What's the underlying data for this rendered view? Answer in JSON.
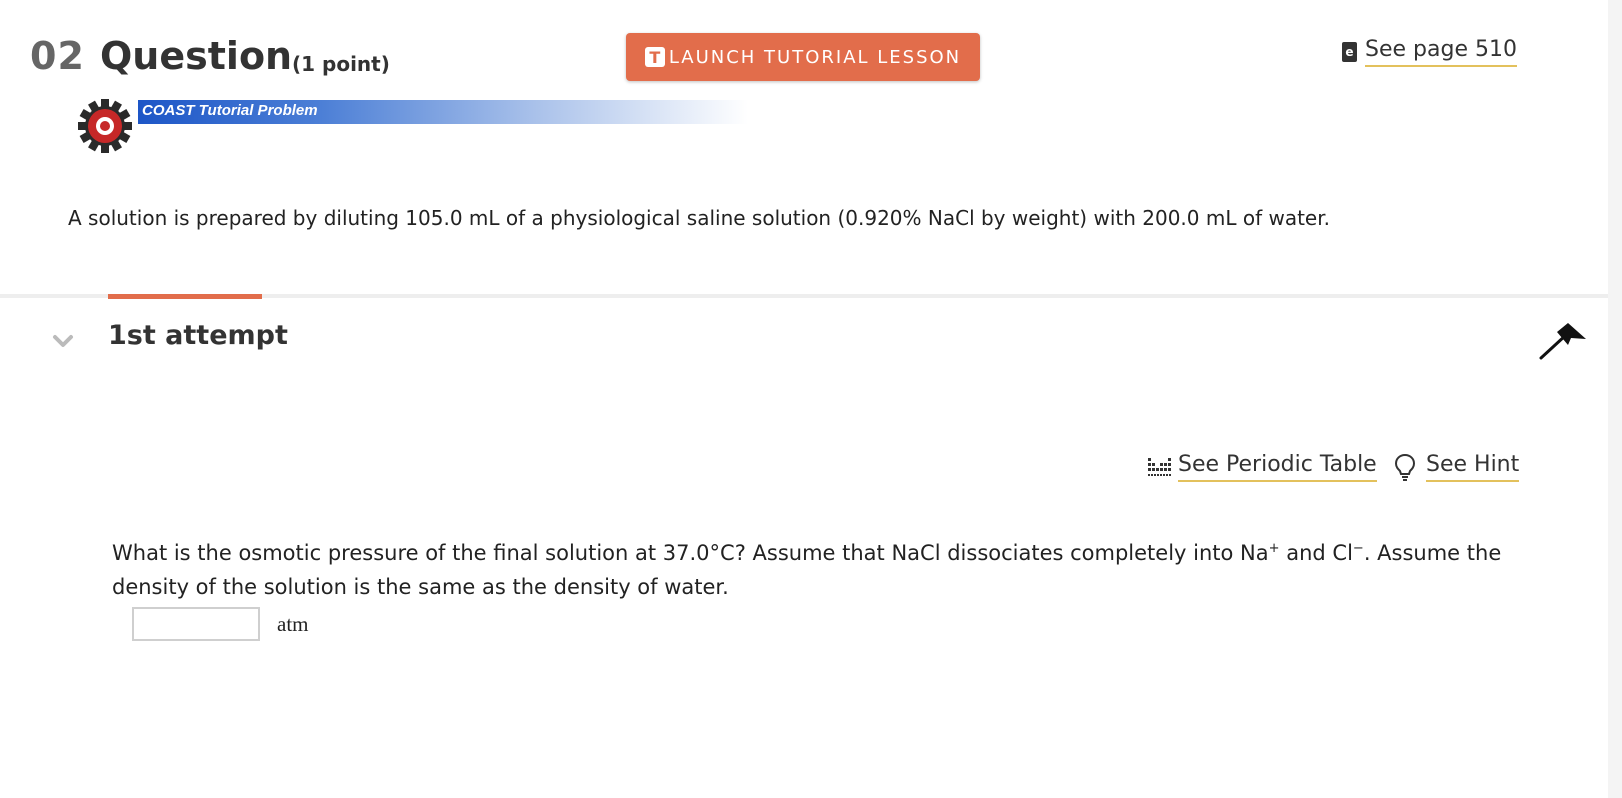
{
  "header": {
    "number": "02",
    "title": "Question",
    "points": "(1 point)",
    "launch_button": {
      "icon_letter": "T",
      "label": "LAUNCH TUTORIAL LESSON"
    },
    "see_page": {
      "icon_letter": "e",
      "label": "See page 510"
    }
  },
  "tutorial": {
    "banner_label": "COAST Tutorial Problem"
  },
  "problem": {
    "text": "A solution is prepared by diluting 105.0 mL of a physiological saline solution (0.920% NaCl by weight) with 200.0 mL of water."
  },
  "attempt": {
    "title": "1st attempt",
    "links": {
      "periodic_table": "See Periodic Table",
      "hint": "See Hint"
    },
    "question": {
      "part1": "What is the osmotic pressure of the final solution at 37.0°C? Assume that NaCl dissociates completely into Na",
      "sup1": "+",
      "part2": " and Cl",
      "sup2": "−",
      "part3": ". Assume the density of the solution is the same as the density of water."
    },
    "answer": {
      "value": "",
      "unit": "atm"
    }
  },
  "colors": {
    "accent": "#e26d4b",
    "link_underline": "#e3c15c",
    "banner_blue": "#1d56c7"
  }
}
